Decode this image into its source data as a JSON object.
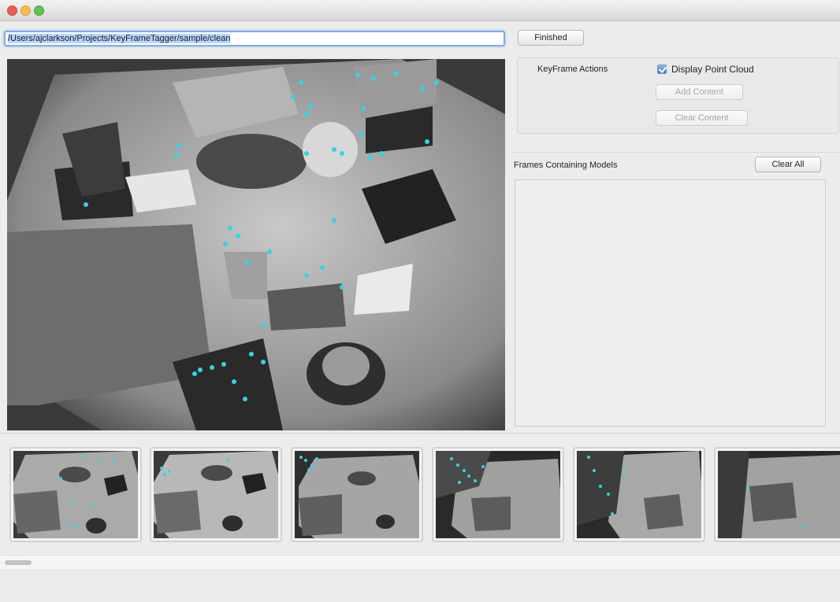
{
  "window": {
    "title": ""
  },
  "toolbar": {
    "path_value": "/Users/ajclarkson/Projects/KeyFrameTagger/sample/clean",
    "finished_label": "Finished"
  },
  "keyframe_actions": {
    "label": "KeyFrame Actions",
    "display_point_cloud_label": "Display Point Cloud",
    "display_point_cloud_checked": true,
    "add_content_label": "Add Content",
    "clear_content_label": "Clear Content"
  },
  "frames_panel": {
    "label": "Frames Containing Models",
    "clear_all_label": "Clear All",
    "items": []
  },
  "thumbnails": {
    "count_visible": 6
  },
  "colors": {
    "feature_point": "#2fd6e6",
    "selection_focus": "#7eaee6"
  }
}
